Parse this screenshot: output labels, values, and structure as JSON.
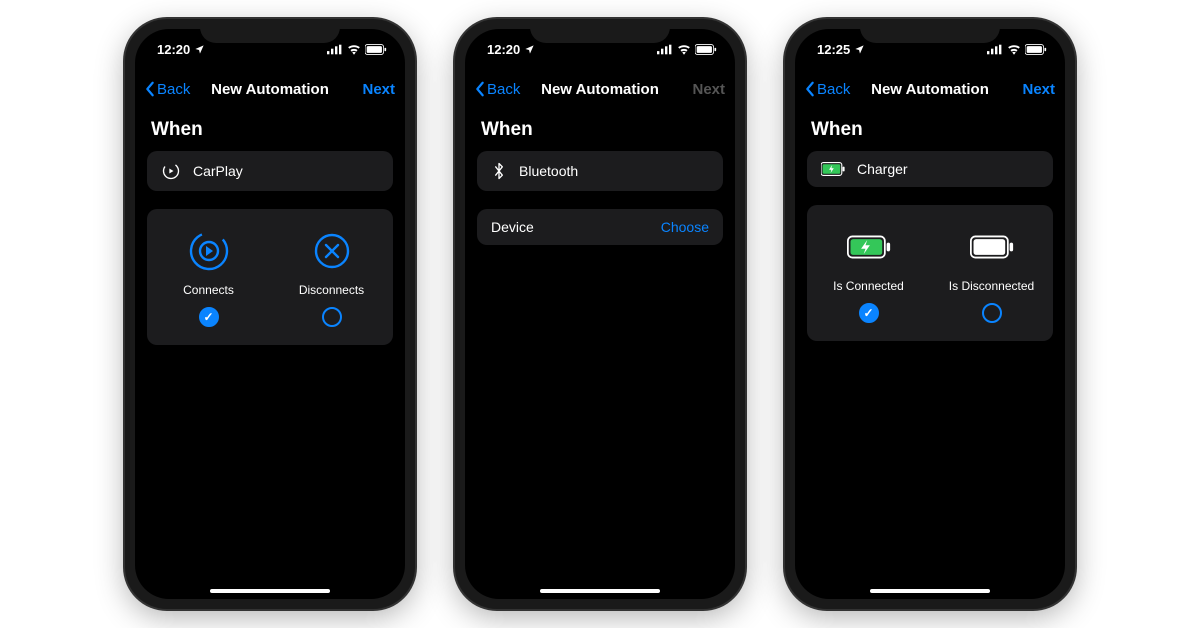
{
  "phones": [
    {
      "time": "12:20",
      "back": "Back",
      "title": "New Automation",
      "next": "Next",
      "next_enabled": true,
      "section": "When",
      "trigger": "CarPlay",
      "options": {
        "a_label": "Connects",
        "b_label": "Disconnects"
      }
    },
    {
      "time": "12:20",
      "back": "Back",
      "title": "New Automation",
      "next": "Next",
      "next_enabled": false,
      "section": "When",
      "trigger": "Bluetooth",
      "device_label": "Device",
      "device_action": "Choose"
    },
    {
      "time": "12:25",
      "back": "Back",
      "title": "New Automation",
      "next": "Next",
      "next_enabled": true,
      "section": "When",
      "trigger": "Charger",
      "options": {
        "a_label": "Is Connected",
        "b_label": "Is Disconnected"
      }
    }
  ]
}
